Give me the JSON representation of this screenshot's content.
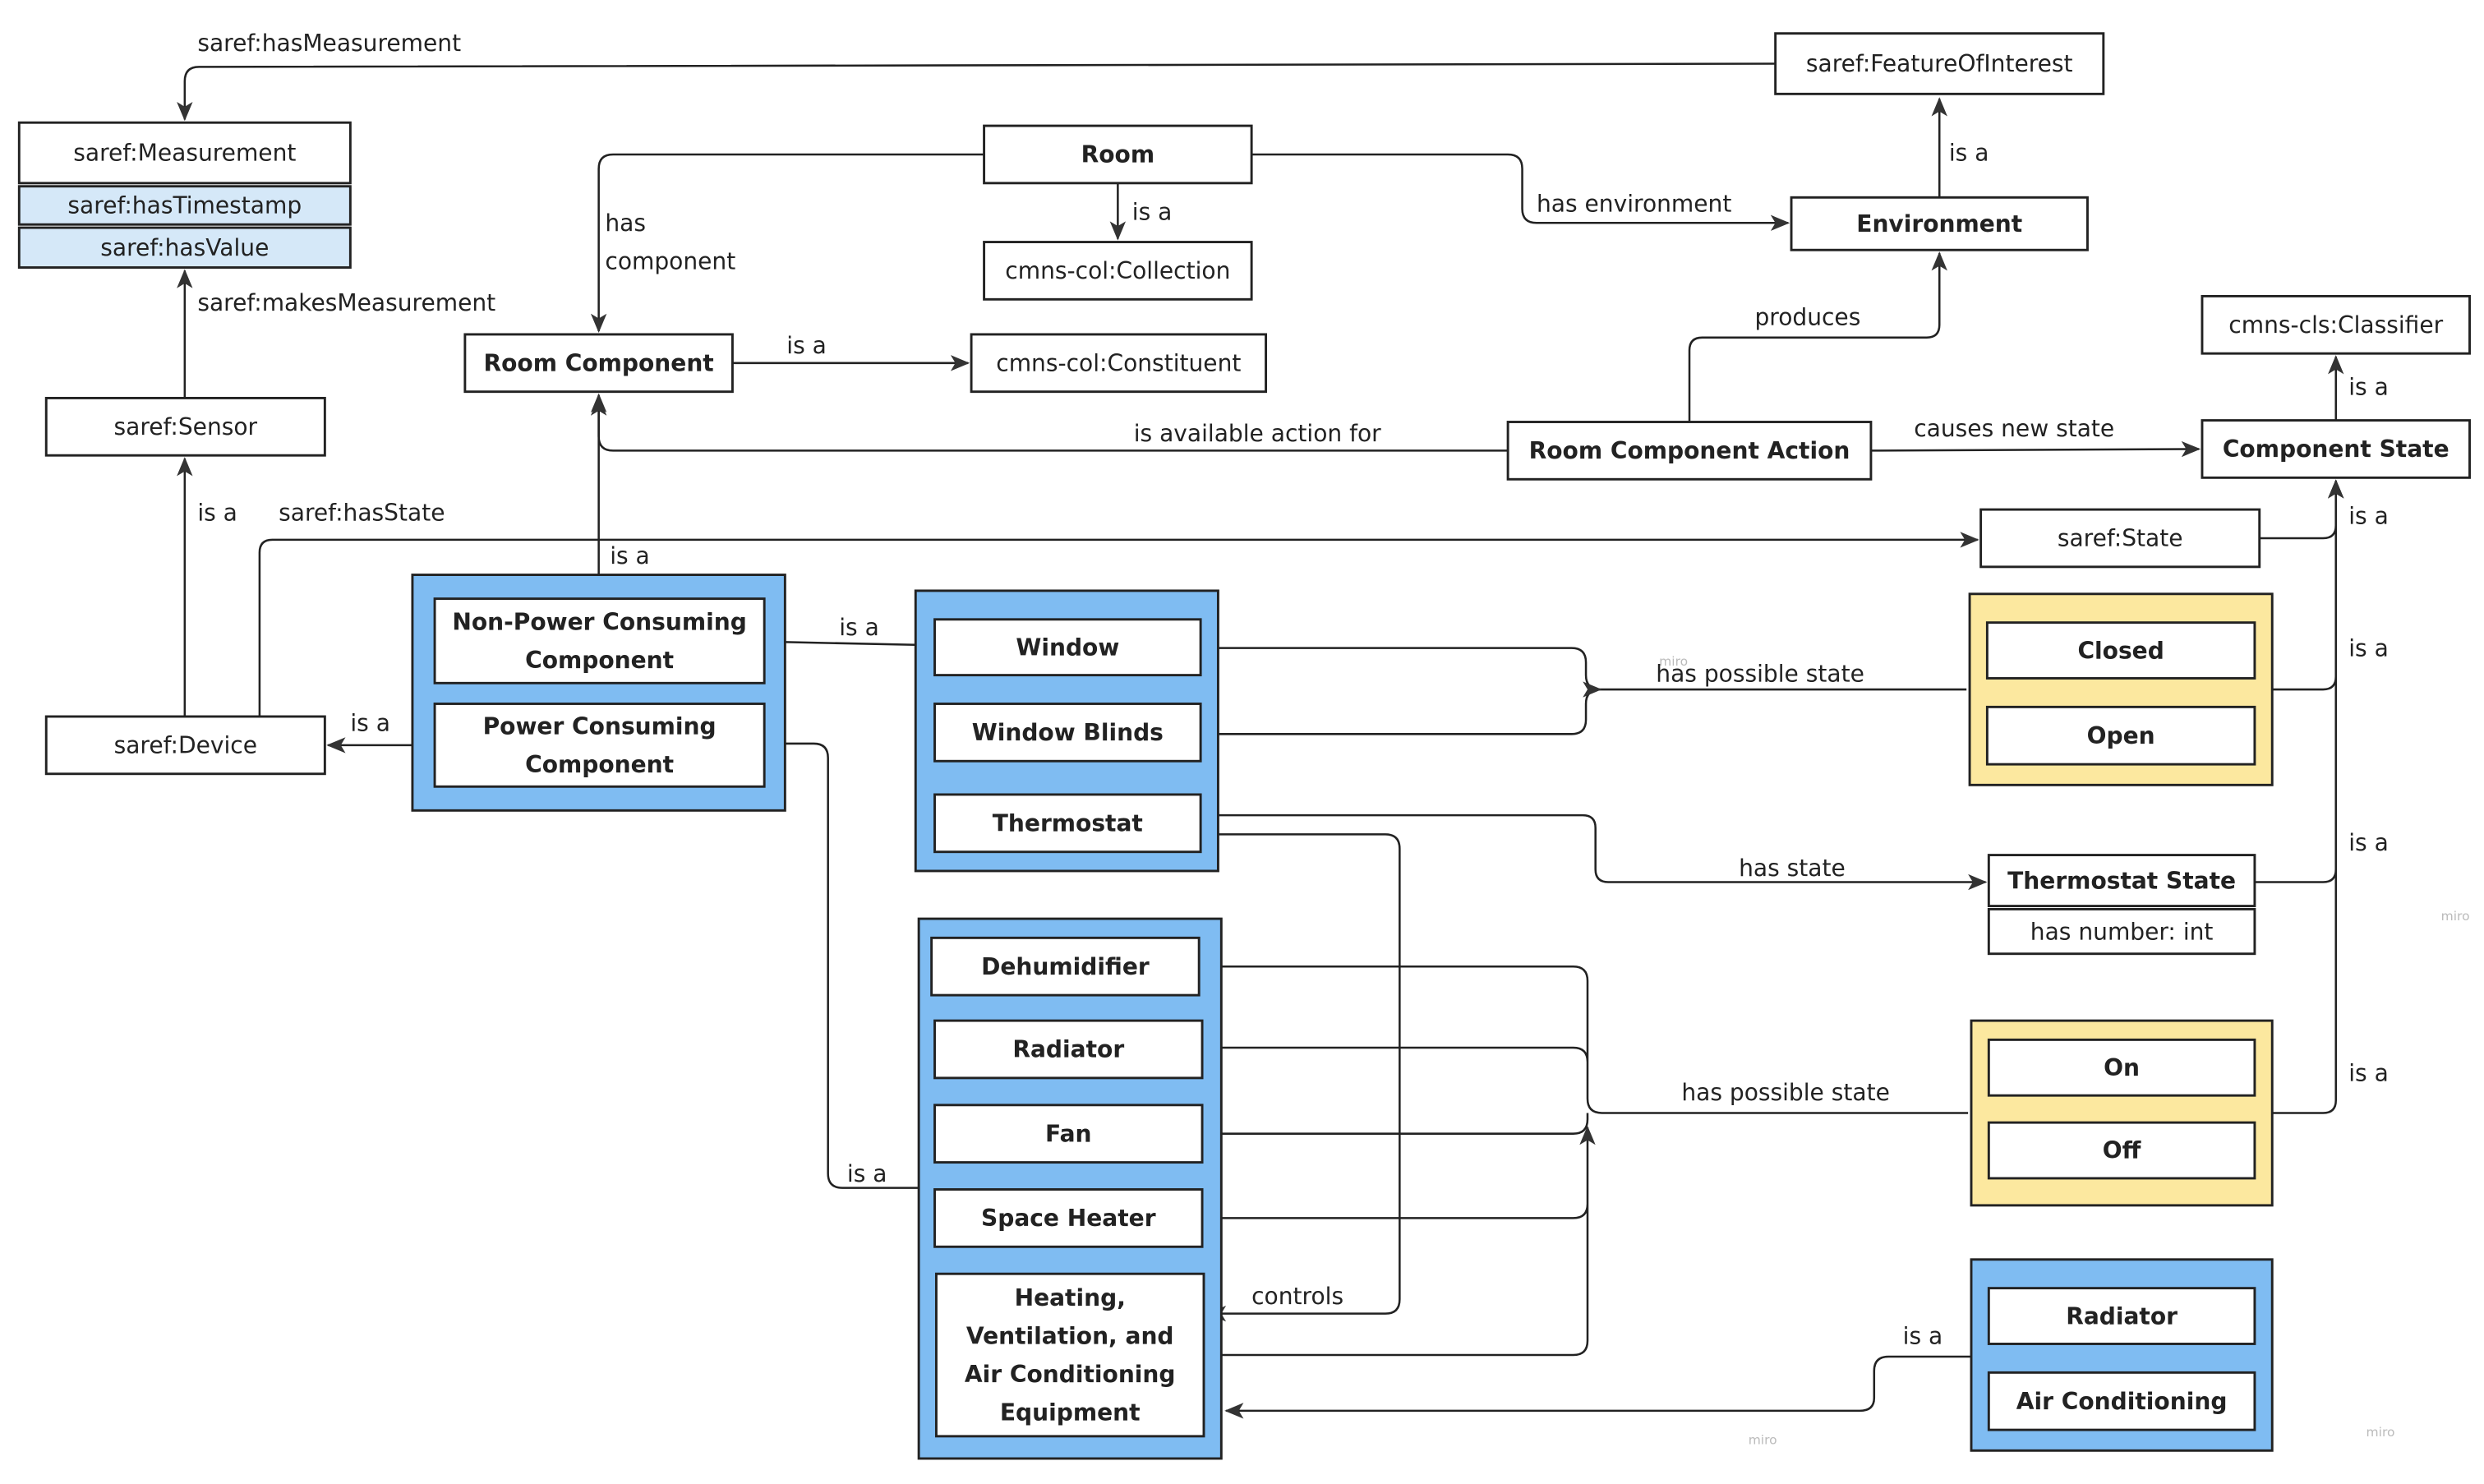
{
  "colors": {
    "group_blue": "#7fbcf2",
    "state_yellow": "#fce89f",
    "attribute_blue": "#d5e8f8",
    "line": "#222222"
  },
  "nodes": {
    "measurement": {
      "lines": [
        "saref:Measurement"
      ],
      "bold": false,
      "fill": "#ffffff"
    },
    "timestamp": {
      "lines": [
        "saref:hasTimestamp"
      ],
      "bold": false,
      "fill": "#d5e8f8"
    },
    "value": {
      "lines": [
        "saref:hasValue"
      ],
      "bold": false,
      "fill": "#d5e8f8"
    },
    "sensor": {
      "lines": [
        "saref:Sensor"
      ],
      "bold": false,
      "fill": "#ffffff"
    },
    "device": {
      "lines": [
        "saref:Device"
      ],
      "bold": false,
      "fill": "#ffffff"
    },
    "foi": {
      "lines": [
        "saref:FeatureOfInterest"
      ],
      "bold": false,
      "fill": "#ffffff"
    },
    "room": {
      "lines": [
        "Room"
      ],
      "bold": true,
      "fill": "#ffffff"
    },
    "collection": {
      "lines": [
        "cmns-col:Collection"
      ],
      "bold": false,
      "fill": "#ffffff"
    },
    "roomcomp": {
      "lines": [
        "Room Component"
      ],
      "bold": true,
      "fill": "#ffffff"
    },
    "constituent": {
      "lines": [
        "cmns-col:Constituent"
      ],
      "bold": false,
      "fill": "#ffffff"
    },
    "environment": {
      "lines": [
        "Environment"
      ],
      "bold": true,
      "fill": "#ffffff"
    },
    "classifier": {
      "lines": [
        "cmns-cls:Classifier"
      ],
      "bold": false,
      "fill": "#ffffff"
    },
    "rca": {
      "lines": [
        "Room Component Action"
      ],
      "bold": true,
      "fill": "#ffffff"
    },
    "compstate": {
      "lines": [
        "Component State"
      ],
      "bold": true,
      "fill": "#ffffff"
    },
    "state": {
      "lines": [
        "saref:State"
      ],
      "bold": false,
      "fill": "#ffffff"
    },
    "group1": {
      "lines": [],
      "bold": false,
      "fill": "#7fbcf2"
    },
    "npc": {
      "lines": [
        "Non-Power Consuming",
        "Component"
      ],
      "bold": true,
      "fill": "#ffffff"
    },
    "pc": {
      "lines": [
        "Power Consuming",
        "Component"
      ],
      "bold": true,
      "fill": "#ffffff"
    },
    "group2": {
      "lines": [],
      "bold": false,
      "fill": "#7fbcf2"
    },
    "window": {
      "lines": [
        "Window"
      ],
      "bold": true,
      "fill": "#ffffff"
    },
    "blinds": {
      "lines": [
        "Window Blinds"
      ],
      "bold": true,
      "fill": "#ffffff"
    },
    "thermostat": {
      "lines": [
        "Thermostat"
      ],
      "bold": true,
      "fill": "#ffffff"
    },
    "group3": {
      "lines": [],
      "bold": false,
      "fill": "#7fbcf2"
    },
    "dehum": {
      "lines": [
        "Dehumidifier"
      ],
      "bold": true,
      "fill": "#ffffff"
    },
    "radiator": {
      "lines": [
        "Radiator"
      ],
      "bold": true,
      "fill": "#ffffff"
    },
    "fan": {
      "lines": [
        "Fan"
      ],
      "bold": true,
      "fill": "#ffffff"
    },
    "heater": {
      "lines": [
        "Space Heater"
      ],
      "bold": true,
      "fill": "#ffffff"
    },
    "hvac": {
      "lines": [
        "Heating,",
        "Ventilation, and",
        "Air Conditioning",
        "Equipment"
      ],
      "bold": true,
      "fill": "#ffffff"
    },
    "yellow1": {
      "lines": [],
      "bold": false,
      "fill": "#fce89f"
    },
    "closed": {
      "lines": [
        "Closed"
      ],
      "bold": true,
      "fill": "#ffffff"
    },
    "open": {
      "lines": [
        "Open"
      ],
      "bold": true,
      "fill": "#ffffff"
    },
    "tstate": {
      "lines": [
        "Thermostat State"
      ],
      "bold": true,
      "fill": "#ffffff"
    },
    "tstate_attr": {
      "lines": [
        "has number: int"
      ],
      "bold": false,
      "fill": "#ffffff"
    },
    "yellow2": {
      "lines": [],
      "bold": false,
      "fill": "#fce89f"
    },
    "on": {
      "lines": [
        "On"
      ],
      "bold": true,
      "fill": "#ffffff"
    },
    "off": {
      "lines": [
        "Off"
      ],
      "bold": true,
      "fill": "#ffffff"
    },
    "group4": {
      "lines": [],
      "bold": false,
      "fill": "#7fbcf2"
    },
    "radiator2": {
      "lines": [
        "Radiator"
      ],
      "bold": true,
      "fill": "#ffffff"
    },
    "ac": {
      "lines": [
        "Air Conditioning"
      ],
      "bold": true,
      "fill": "#ffffff"
    }
  },
  "edges": {
    "hasMeasurement": {
      "labels": [
        "saref:hasMeasurement"
      ]
    },
    "makesMeasurement": {
      "labels": [
        "saref:makesMeasurement"
      ]
    },
    "deviceIsSensor": {
      "labels": [
        "is a"
      ]
    },
    "hasState": {
      "labels": [
        "saref:hasState"
      ]
    },
    "hasComponent": {
      "labels": [
        "has",
        "component"
      ]
    },
    "roomIsCollection": {
      "labels": [
        "is a"
      ]
    },
    "hasEnvironment": {
      "labels": [
        "has environment"
      ]
    },
    "envIsFoi": {
      "labels": [
        "is a"
      ]
    },
    "rcIsConstituent": {
      "labels": [
        "is a"
      ]
    },
    "produces": {
      "labels": [
        "produces"
      ]
    },
    "availableAction": {
      "labels": [
        "is available action for"
      ]
    },
    "causesNewState": {
      "labels": [
        "causes new state"
      ]
    },
    "csIsClassifier": {
      "labels": [
        "is a"
      ]
    },
    "stateIsCs": {
      "labels": [
        "is a"
      ]
    },
    "group1IsRc": {
      "labels": [
        "is a"
      ]
    },
    "group1IsDevice": {
      "labels": [
        "is a"
      ]
    },
    "group2IsNpc": {
      "labels": [
        "is a"
      ]
    },
    "windowPossibleState": {
      "labels": [
        "has possible state"
      ]
    },
    "yellow1IsCs": {
      "labels": [
        "is a"
      ]
    },
    "thermostatHasState": {
      "labels": [
        "has state"
      ]
    },
    "tstateIsCs": {
      "labels": [
        "is a"
      ]
    },
    "controls": {
      "labels": [
        "controls"
      ]
    },
    "devicesPossibleState": {
      "labels": [
        "has possible state"
      ]
    },
    "yellow2IsCs": {
      "labels": [
        "is a"
      ]
    },
    "group3IsPc": {
      "labels": [
        "is a"
      ]
    },
    "group4IsHvac": {
      "labels": [
        "is a"
      ]
    }
  },
  "watermark": "miro"
}
